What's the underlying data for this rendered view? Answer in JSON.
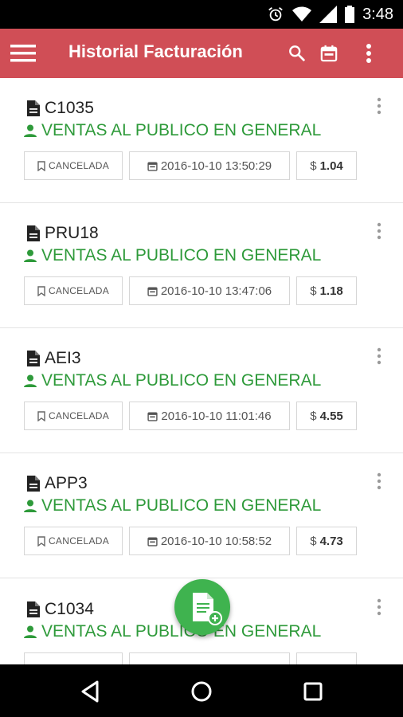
{
  "status_bar": {
    "time": "3:48"
  },
  "app_bar": {
    "title": "Historial Facturación"
  },
  "invoices": [
    {
      "id": "C1035",
      "client": "VENTAS AL PUBLICO EN GENERAL",
      "status": "CANCELADA",
      "date": "2016-10-10 13:50:29",
      "currency": "$",
      "amount": "1.04"
    },
    {
      "id": "PRU18",
      "client": "VENTAS AL PUBLICO EN GENERAL",
      "status": "CANCELADA",
      "date": "2016-10-10 13:47:06",
      "currency": "$",
      "amount": "1.18"
    },
    {
      "id": "AEI3",
      "client": "VENTAS AL PUBLICO EN GENERAL",
      "status": "CANCELADA",
      "date": "2016-10-10 11:01:46",
      "currency": "$",
      "amount": "4.55"
    },
    {
      "id": "APP3",
      "client": "VENTAS AL PUBLICO EN GENERAL",
      "status": "CANCELADA",
      "date": "2016-10-10 10:58:52",
      "currency": "$",
      "amount": "4.73"
    },
    {
      "id": "C1034",
      "client": "VENTAS AL PUBLICO EN GENERAL",
      "status": "",
      "date": "",
      "currency": "",
      "amount": ""
    }
  ],
  "colors": {
    "app_bar": "#d04e56",
    "client_text": "#2e9a3a",
    "fab": "#3fb34f"
  }
}
